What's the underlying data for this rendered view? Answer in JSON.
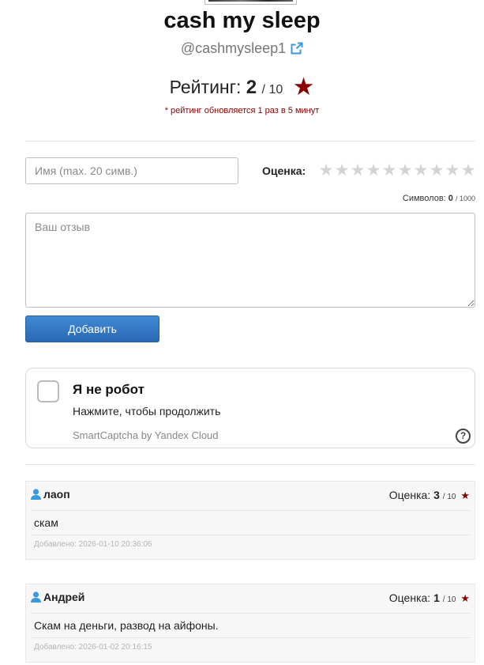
{
  "profile": {
    "name": "cash my sleep",
    "handle": "@cashmysleep1",
    "rating_label": "Рейтинг:",
    "rating_value": "2",
    "rating_max": "/ 10",
    "rating_note": "* рейтинг обновляется 1 раз в 5 минут"
  },
  "form": {
    "name_placeholder": "Имя (max. 20 симв.)",
    "score_label": "Оценка:",
    "star_count": 10,
    "counter_label": "Символов:",
    "counter_value": "0",
    "counter_max": "/ 1000",
    "review_placeholder": "Ваш отзыв",
    "submit_label": "Добавить"
  },
  "captcha": {
    "title": "Я не робот",
    "subtitle": "Нажмите, чтобы продолжить",
    "brand": "SmartCaptcha by Yandex Cloud",
    "help_glyph": "?"
  },
  "comments": [
    {
      "author": "лаоп",
      "score_label": "Оценка:",
      "score": "3",
      "score_max": "/ 10",
      "text": "скам",
      "date": "Добавлено: 2026-01-10 20:36:06"
    },
    {
      "author": "Андрей",
      "score_label": "Оценка:",
      "score": "1",
      "score_max": "/ 10",
      "text": "Скам на деньги, развод на айфоны.",
      "date": "Добавлено: 2026-01-02 20:16:15"
    }
  ],
  "colors": {
    "accent_red": "#8b0000",
    "button_blue": "#2a69b3",
    "link_blue": "#3a9ae0",
    "star_empty": "#d4d4d4"
  },
  "icons": {
    "external_link": "external-link-icon",
    "star": "star-icon",
    "user": "user-icon",
    "help": "question-circle-icon"
  }
}
